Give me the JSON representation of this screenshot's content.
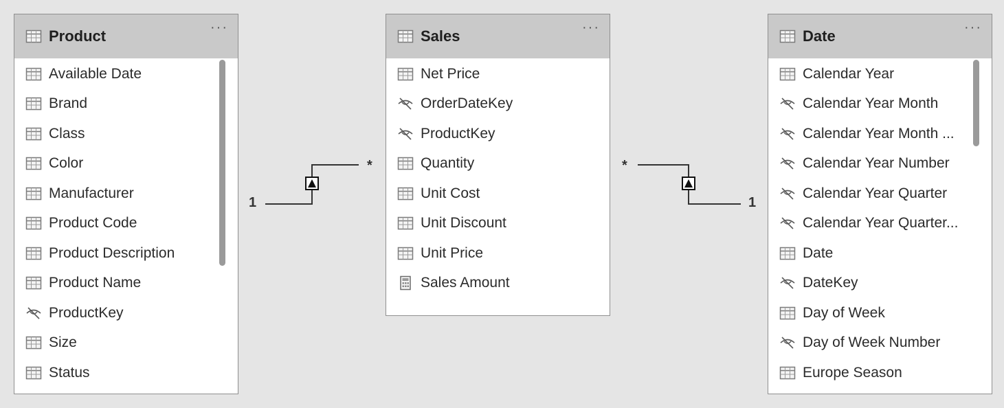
{
  "tables": [
    {
      "name": "Product",
      "menu": "···",
      "fields": [
        {
          "label": "Available Date",
          "icon": "table-column-icon"
        },
        {
          "label": "Brand",
          "icon": "table-column-icon"
        },
        {
          "label": "Class",
          "icon": "table-column-icon"
        },
        {
          "label": "Color",
          "icon": "table-column-icon"
        },
        {
          "label": "Manufacturer",
          "icon": "table-column-icon"
        },
        {
          "label": "Product Code",
          "icon": "table-column-icon"
        },
        {
          "label": "Product Description",
          "icon": "table-column-icon"
        },
        {
          "label": "Product Name",
          "icon": "table-column-icon"
        },
        {
          "label": "ProductKey",
          "icon": "hidden-column-icon"
        },
        {
          "label": "Size",
          "icon": "table-column-icon"
        },
        {
          "label": "Status",
          "icon": "table-column-icon"
        }
      ]
    },
    {
      "name": "Sales",
      "menu": "···",
      "fields": [
        {
          "label": "Net Price",
          "icon": "table-column-icon"
        },
        {
          "label": "OrderDateKey",
          "icon": "hidden-column-icon"
        },
        {
          "label": "ProductKey",
          "icon": "hidden-column-icon"
        },
        {
          "label": "Quantity",
          "icon": "table-column-icon"
        },
        {
          "label": "Unit Cost",
          "icon": "table-column-icon"
        },
        {
          "label": "Unit Discount",
          "icon": "table-column-icon"
        },
        {
          "label": "Unit Price",
          "icon": "table-column-icon"
        },
        {
          "label": "Sales Amount",
          "icon": "measure-calculator-icon"
        }
      ]
    },
    {
      "name": "Date",
      "menu": "···",
      "fields": [
        {
          "label": "Calendar Year",
          "icon": "table-column-icon"
        },
        {
          "label": "Calendar Year Month",
          "icon": "hidden-column-icon"
        },
        {
          "label": "Calendar Year Month ...",
          "icon": "hidden-column-icon"
        },
        {
          "label": "Calendar Year Number",
          "icon": "hidden-column-icon"
        },
        {
          "label": "Calendar Year Quarter",
          "icon": "hidden-column-icon"
        },
        {
          "label": "Calendar Year Quarter...",
          "icon": "hidden-column-icon"
        },
        {
          "label": "Date",
          "icon": "table-column-icon"
        },
        {
          "label": "DateKey",
          "icon": "hidden-column-icon"
        },
        {
          "label": "Day of Week",
          "icon": "table-column-icon"
        },
        {
          "label": "Day of Week Number",
          "icon": "hidden-column-icon"
        },
        {
          "label": "Europe Season",
          "icon": "table-column-icon"
        }
      ]
    }
  ],
  "relationships": [
    {
      "from": "Product",
      "to": "Sales",
      "one_label": "1",
      "many_label": "*"
    },
    {
      "from": "Date",
      "to": "Sales",
      "one_label": "1",
      "many_label": "*"
    }
  ],
  "colors": {
    "header": "#c9c9c9",
    "canvas": "#e5e5e5",
    "border": "#8f8f8f"
  }
}
